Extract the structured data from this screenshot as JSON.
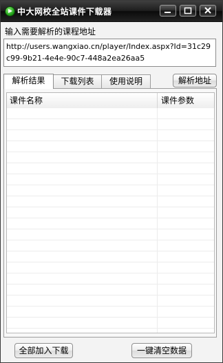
{
  "window": {
    "title": "中大网校全站课件下载器",
    "icon": "play-icon"
  },
  "form": {
    "url_label": "输入需要解析的课程地址",
    "url_value": "http://users.wangxiao.cn/player/Index.aspx?Id=31c29c99-9b21-4e4e-90c7-448a2ea26aa5"
  },
  "tabs": [
    {
      "label": "解析结果",
      "active": true
    },
    {
      "label": "下载列表",
      "active": false
    },
    {
      "label": "使用说明",
      "active": false
    }
  ],
  "buttons": {
    "parse": "解析地址",
    "add_all": "全部加入下载",
    "clear_all": "一键清空数据"
  },
  "list": {
    "columns": [
      "课件名称",
      "课件参数"
    ],
    "rows": []
  }
}
